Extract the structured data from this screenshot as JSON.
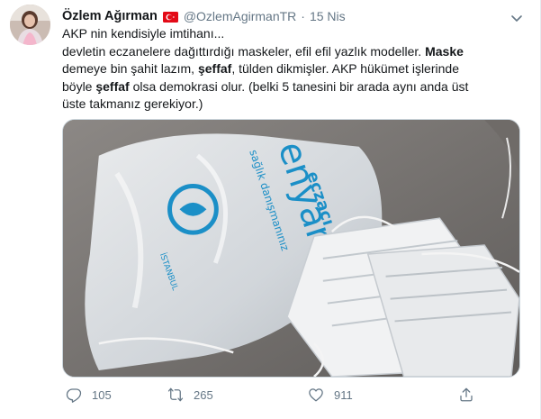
{
  "tweet": {
    "author_name": "Özlem Ağırman",
    "handle": "@OzlemAgirmanTR",
    "separator": "·",
    "date": "15 Nis",
    "text_lines": {
      "l1": "AKP nin kendisiyle imtihanı...",
      "l2": "devletin eczanelere dağıttırdığı maskeler, efil efil yazlık modeller. ",
      "l2_bold": "Maske",
      "l3": " demeye bin şahit lazım, ",
      "l3_bold": "şeffaf",
      "l3_rest": ", tülden dikmişler. AKP hükümet işlerinde",
      "l4": "böyle ",
      "l4_bold": "şeffaf",
      "l4_rest": " olsa demokrasi olur. (belki 5 tanesini bir arada aynı anda üst",
      "l5": "üste takmanız gerekiyor.)"
    },
    "media": {
      "bag_text_1": "eczacı",
      "bag_text_2": "enyar",
      "bag_text_3": "sağlık danışmanınız",
      "bag_text_4": "İSTANBUL"
    },
    "icons": {
      "flag": "turkey-flag-icon",
      "caret": "chevron-down-icon",
      "reply": "reply-icon",
      "retweet": "retweet-icon",
      "like": "heart-icon",
      "share": "share-icon"
    },
    "counts": {
      "replies": "105",
      "retweets": "265",
      "likes": "911"
    },
    "colors": {
      "secondary_text": "#657786",
      "flag_red": "#e30a17"
    }
  }
}
